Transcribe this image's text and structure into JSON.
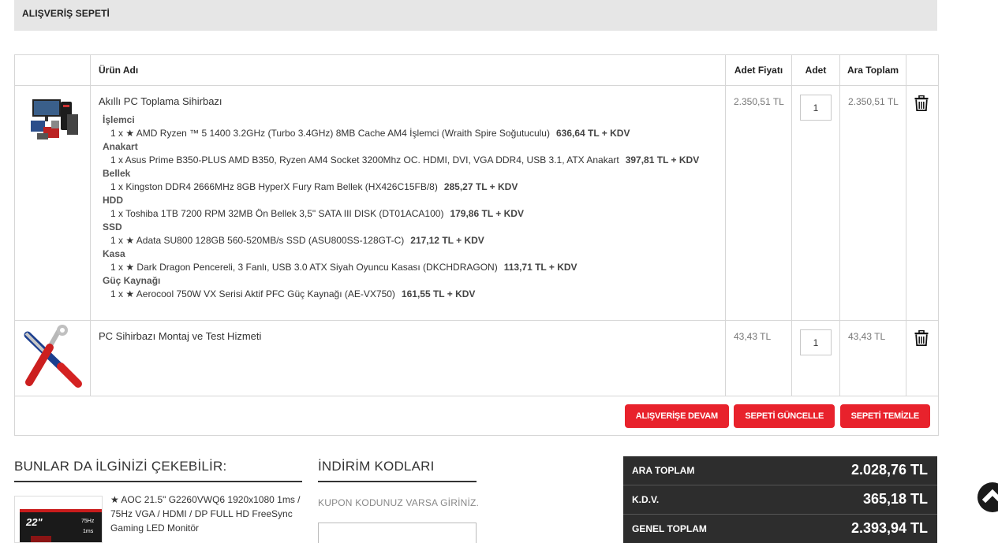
{
  "header": {
    "title": "ALIŞVERİŞ SEPETİ"
  },
  "table": {
    "headers": {
      "product": "Ürün Adı",
      "unit_price": "Adet Fiyatı",
      "qty": "Adet",
      "subtotal": "Ara Toplam"
    }
  },
  "items": [
    {
      "name": "Akıllı PC Toplama Sihirbazı",
      "unit_price": "2.350,51 TL",
      "qty": "1",
      "subtotal": "2.350,51 TL",
      "specs": [
        {
          "category": "İşlemci",
          "text": "1 x ★ AMD Ryzen ™ 5 1400 3.2GHz (Turbo 3.4GHz) 8MB Cache AM4 İşlemci (Wraith Spire Soğutuculu)",
          "price": "636,64 TL + KDV"
        },
        {
          "category": "Anakart",
          "text": "1 x Asus Prime B350-PLUS AMD B350, Ryzen AM4 Socket 3200Mhz OC. HDMI, DVI, VGA DDR4, USB 3.1, ATX Anakart",
          "price": "397,81 TL + KDV"
        },
        {
          "category": "Bellek",
          "text": "1 x Kingston DDR4 2666MHz 8GB HyperX Fury Ram Bellek (HX426C15FB/8)",
          "price": "285,27 TL + KDV"
        },
        {
          "category": "HDD",
          "text": "1 x Toshiba 1TB 7200 RPM 32MB Ön Bellek 3,5\" SATA III DISK (DT01ACA100)",
          "price": "179,86 TL + KDV"
        },
        {
          "category": "SSD",
          "text": "1 x ★ Adata SU800 128GB 560-520MB/s SSD (ASU800SS-128GT-C)",
          "price": "217,12 TL + KDV"
        },
        {
          "category": "Kasa",
          "text": "1 x ★ Dark Dragon Pencereli, 3 Fanlı, USB 3.0 ATX Siyah Oyuncu Kasası (DKCHDRAGON)",
          "price": "113,71 TL + KDV"
        },
        {
          "category": "Güç Kaynağı",
          "text": "1 x ★ Aerocool 750W VX Serisi Aktif PFC Güç Kaynağı (AE-VX750)",
          "price": "161,55 TL + KDV"
        }
      ]
    },
    {
      "name": "PC Sihirbazı Montaj ve Test Hizmeti",
      "unit_price": "43,43 TL",
      "qty": "1",
      "subtotal": "43,43 TL"
    }
  ],
  "actions": {
    "continue": "ALIŞVERİŞE DEVAM",
    "update": "SEPETİ GÜNCELLE",
    "clear": "SEPETİ TEMİZLE"
  },
  "recommend": {
    "title": "BUNLAR DA İLGİNİZİ ÇEKEBİLİR:",
    "product_text": "★ AOC 21.5\" G2260VWQ6 1920x1080 1ms / 75Hz VGA / HDMI / DP FULL HD FreeSync Gaming LED Monitör",
    "badge_size": "22\"",
    "badge_hz": "75Hz",
    "badge_ms": "1ms"
  },
  "coupon": {
    "title": "İNDİRİM KODLARI",
    "label": "KUPON KODUNUZ VARSA GİRİNİZ."
  },
  "totals": {
    "subtotal_label": "ARA TOPLAM",
    "subtotal_value": "2.028,76 TL",
    "tax_label": "K.D.V.",
    "tax_value": "365,18 TL",
    "grand_label": "GENEL TOPLAM",
    "grand_value": "2.393,94 TL"
  },
  "colors": {
    "accent_red": "#e8222c",
    "totals_bg": "#2d2d2d",
    "header_bg": "#e6e6e6"
  },
  "icons": {
    "delete": "trash-icon",
    "scroll_top": "chevron-up-icon"
  }
}
